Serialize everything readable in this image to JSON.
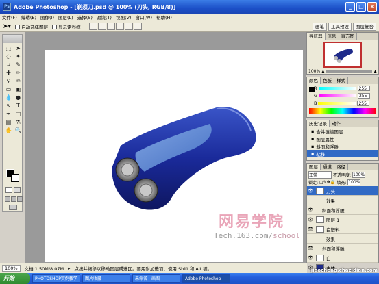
{
  "window": {
    "title": "Adobe Photoshop - [剃须刀.psd @ 100% (刀头, RGB/8)]"
  },
  "menu": [
    "文件(F)",
    "编辑(E)",
    "图像(I)",
    "图层(L)",
    "选择(S)",
    "滤镜(T)",
    "视图(V)",
    "窗口(W)",
    "帮助(H)"
  ],
  "options": {
    "auto_select": "自动选择图层",
    "show_bounds": "显示定界框",
    "tabs": [
      "画笔",
      "工具预设",
      "图层复合"
    ]
  },
  "watermark": {
    "brand": "网易学院",
    "url_main": "Tech.163.com/",
    "url_school": "school"
  },
  "status": {
    "zoom": "100%",
    "doc": "文档:1.50M/8.07M",
    "hint": "点按并拖移以移动图层或选区。要用附加选项，使用 Shift 和 Alt 键。"
  },
  "navigator": {
    "tabs": [
      "导航器",
      "信息",
      "直方图"
    ],
    "zoom": "100%"
  },
  "color_panel": {
    "tabs": [
      "颜色",
      "色板",
      "样式"
    ],
    "channels": [
      {
        "label": "R",
        "value": "255"
      },
      {
        "label": "G",
        "value": "255"
      },
      {
        "label": "B",
        "value": "255"
      }
    ]
  },
  "history": {
    "tabs": [
      "历史记录",
      "动作"
    ],
    "items": [
      "合并链接图层",
      "图层属性",
      "斜面和浮雕",
      "粘移"
    ]
  },
  "layers": {
    "tabs": [
      "图层",
      "通道",
      "路径"
    ],
    "blend": "正常",
    "opacity_label": "不透明度:",
    "opacity": "100%",
    "lock_label": "锁定:",
    "fill_label": "填充:",
    "fill": "100%",
    "rows": [
      {
        "name": "刀头",
        "fx": true
      },
      {
        "name": "效果",
        "sub": true
      },
      {
        "name": "斜面和浮雕",
        "sub": true
      },
      {
        "name": "图层 1"
      },
      {
        "name": "白塑料",
        "fx": true
      },
      {
        "name": "效果",
        "sub": true
      },
      {
        "name": "斜面和浮雕",
        "sub": true
      },
      {
        "name": "白"
      },
      {
        "name": "主体"
      }
    ]
  },
  "taskbar": {
    "start": "开始",
    "tasks": [
      "PHOTOSHOP实例教学",
      "图片收藏",
      "未命名 - 画图",
      "Adobe Photoshop"
    ],
    "site": "jiaocheng.chazidian.com"
  },
  "colors": {
    "accent": "#245edb",
    "razor": "#1e2a8a"
  }
}
